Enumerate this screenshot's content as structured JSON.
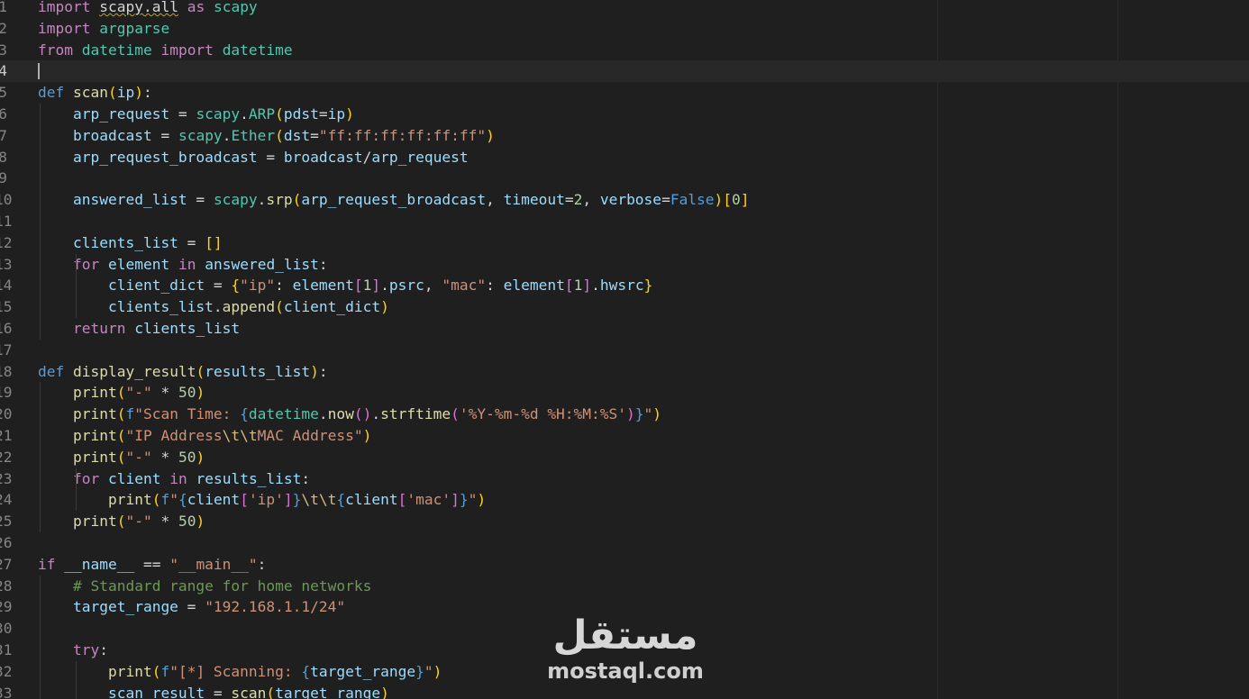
{
  "editor": {
    "current_line": 4,
    "lines": [
      {
        "num": "1",
        "tokens": [
          [
            "import",
            "ctrl"
          ],
          [
            " ",
            ""
          ],
          [
            "scapy.all",
            "sq"
          ],
          [
            " ",
            ""
          ],
          [
            "as",
            "ctrl"
          ],
          [
            " ",
            ""
          ],
          [
            "scapy",
            "mod"
          ]
        ]
      },
      {
        "num": "2",
        "tokens": [
          [
            "import",
            "ctrl"
          ],
          [
            " ",
            ""
          ],
          [
            "argparse",
            "mod"
          ]
        ]
      },
      {
        "num": "3",
        "tokens": [
          [
            "from",
            "ctrl"
          ],
          [
            " ",
            ""
          ],
          [
            "datetime",
            "mod"
          ],
          [
            " ",
            ""
          ],
          [
            "import",
            "ctrl"
          ],
          [
            " ",
            ""
          ],
          [
            "datetime",
            "cls"
          ]
        ]
      },
      {
        "num": "4",
        "tokens": []
      },
      {
        "num": "5",
        "tokens": [
          [
            "def",
            "kw"
          ],
          [
            " ",
            ""
          ],
          [
            "scan",
            "fn"
          ],
          [
            "(",
            "b1"
          ],
          [
            "ip",
            "par"
          ],
          [
            ")",
            "b1"
          ],
          [
            ":",
            ""
          ]
        ]
      },
      {
        "num": "6",
        "tokens": [
          [
            "    arp_request",
            "vr"
          ],
          [
            " = ",
            ""
          ],
          [
            "scapy",
            "mod"
          ],
          [
            ".",
            ""
          ],
          [
            "ARP",
            "cls"
          ],
          [
            "(",
            "b1"
          ],
          [
            "pdst",
            "par"
          ],
          [
            "=",
            ""
          ],
          [
            "ip",
            "par"
          ],
          [
            ")",
            "b1"
          ]
        ]
      },
      {
        "num": "7",
        "tokens": [
          [
            "    broadcast",
            "vr"
          ],
          [
            " = ",
            ""
          ],
          [
            "scapy",
            "mod"
          ],
          [
            ".",
            ""
          ],
          [
            "Ether",
            "cls"
          ],
          [
            "(",
            "b1"
          ],
          [
            "dst",
            "par"
          ],
          [
            "=",
            ""
          ],
          [
            "\"ff:ff:ff:ff:ff:ff\"",
            "str"
          ],
          [
            ")",
            "b1"
          ]
        ]
      },
      {
        "num": "8",
        "tokens": [
          [
            "    arp_request_broadcast",
            "vr"
          ],
          [
            " = ",
            ""
          ],
          [
            "broadcast",
            "vr"
          ],
          [
            "/",
            ""
          ],
          [
            "arp_request",
            "vr"
          ]
        ]
      },
      {
        "num": "9",
        "tokens": []
      },
      {
        "num": "10",
        "tokens": [
          [
            "    answered_list",
            "vr"
          ],
          [
            " = ",
            ""
          ],
          [
            "scapy",
            "mod"
          ],
          [
            ".",
            ""
          ],
          [
            "srp",
            "fn"
          ],
          [
            "(",
            "b1"
          ],
          [
            "arp_request_broadcast",
            "vr"
          ],
          [
            ", ",
            ""
          ],
          [
            "timeout",
            "par"
          ],
          [
            "=",
            ""
          ],
          [
            "2",
            "num"
          ],
          [
            ", ",
            ""
          ],
          [
            "verbose",
            "par"
          ],
          [
            "=",
            ""
          ],
          [
            "False",
            "kw"
          ],
          [
            ")",
            "b1"
          ],
          [
            "[",
            "b1"
          ],
          [
            "0",
            "num"
          ],
          [
            "]",
            "b1"
          ]
        ]
      },
      {
        "num": "11",
        "tokens": []
      },
      {
        "num": "12",
        "tokens": [
          [
            "    clients_list",
            "vr"
          ],
          [
            " = ",
            ""
          ],
          [
            "[]",
            "b1"
          ]
        ]
      },
      {
        "num": "13",
        "tokens": [
          [
            "    ",
            ""
          ],
          [
            "for",
            "ctrl"
          ],
          [
            " ",
            ""
          ],
          [
            "element",
            "vr"
          ],
          [
            " ",
            ""
          ],
          [
            "in",
            "ctrl"
          ],
          [
            " ",
            ""
          ],
          [
            "answered_list",
            "vr"
          ],
          [
            ":",
            ""
          ]
        ]
      },
      {
        "num": "14",
        "tokens": [
          [
            "        client_dict",
            "vr"
          ],
          [
            " = ",
            ""
          ],
          [
            "{",
            "b1"
          ],
          [
            "\"ip\"",
            "str"
          ],
          [
            ": ",
            ""
          ],
          [
            "element",
            "vr"
          ],
          [
            "[",
            "b2"
          ],
          [
            "1",
            "num"
          ],
          [
            "]",
            "b2"
          ],
          [
            ".",
            ""
          ],
          [
            "psrc",
            "vr"
          ],
          [
            ", ",
            ""
          ],
          [
            "\"mac\"",
            "str"
          ],
          [
            ": ",
            ""
          ],
          [
            "element",
            "vr"
          ],
          [
            "[",
            "b2"
          ],
          [
            "1",
            "num"
          ],
          [
            "]",
            "b2"
          ],
          [
            ".",
            ""
          ],
          [
            "hwsrc",
            "vr"
          ],
          [
            "}",
            "b1"
          ]
        ]
      },
      {
        "num": "15",
        "tokens": [
          [
            "        clients_list",
            "vr"
          ],
          [
            ".",
            ""
          ],
          [
            "append",
            "fn"
          ],
          [
            "(",
            "b1"
          ],
          [
            "client_dict",
            "vr"
          ],
          [
            ")",
            "b1"
          ]
        ]
      },
      {
        "num": "16",
        "tokens": [
          [
            "    ",
            ""
          ],
          [
            "return",
            "ctrl"
          ],
          [
            " ",
            ""
          ],
          [
            "clients_list",
            "vr"
          ]
        ]
      },
      {
        "num": "17",
        "tokens": []
      },
      {
        "num": "18",
        "tokens": [
          [
            "def",
            "kw"
          ],
          [
            " ",
            ""
          ],
          [
            "display_result",
            "fn"
          ],
          [
            "(",
            "b1"
          ],
          [
            "results_list",
            "par"
          ],
          [
            ")",
            "b1"
          ],
          [
            ":",
            ""
          ]
        ]
      },
      {
        "num": "19",
        "tokens": [
          [
            "    ",
            ""
          ],
          [
            "print",
            "fn"
          ],
          [
            "(",
            "b1"
          ],
          [
            "\"-\"",
            "str"
          ],
          [
            " * ",
            ""
          ],
          [
            "50",
            "num"
          ],
          [
            ")",
            "b1"
          ]
        ]
      },
      {
        "num": "20",
        "tokens": [
          [
            "    ",
            ""
          ],
          [
            "print",
            "fn"
          ],
          [
            "(",
            "b1"
          ],
          [
            "f",
            "kw"
          ],
          [
            "\"Scan Time: ",
            "str"
          ],
          [
            "{",
            "kw"
          ],
          [
            "datetime",
            "cls"
          ],
          [
            ".",
            ""
          ],
          [
            "now",
            "fn"
          ],
          [
            "()",
            "b2"
          ],
          [
            ".",
            ""
          ],
          [
            "strftime",
            "fn"
          ],
          [
            "(",
            "b2"
          ],
          [
            "'%Y-%m-%d %H:%M:%S'",
            "str"
          ],
          [
            ")",
            "b2"
          ],
          [
            "}",
            "kw"
          ],
          [
            "\"",
            "str"
          ],
          [
            ")",
            "b1"
          ]
        ]
      },
      {
        "num": "21",
        "tokens": [
          [
            "    ",
            ""
          ],
          [
            "print",
            "fn"
          ],
          [
            "(",
            "b1"
          ],
          [
            "\"IP Address",
            "str"
          ],
          [
            "\\t\\t",
            "esc"
          ],
          [
            "MAC Address\"",
            "str"
          ],
          [
            ")",
            "b1"
          ]
        ]
      },
      {
        "num": "22",
        "tokens": [
          [
            "    ",
            ""
          ],
          [
            "print",
            "fn"
          ],
          [
            "(",
            "b1"
          ],
          [
            "\"-\"",
            "str"
          ],
          [
            " * ",
            ""
          ],
          [
            "50",
            "num"
          ],
          [
            ")",
            "b1"
          ]
        ]
      },
      {
        "num": "23",
        "tokens": [
          [
            "    ",
            ""
          ],
          [
            "for",
            "ctrl"
          ],
          [
            " ",
            ""
          ],
          [
            "client",
            "vr"
          ],
          [
            " ",
            ""
          ],
          [
            "in",
            "ctrl"
          ],
          [
            " ",
            ""
          ],
          [
            "results_list",
            "par"
          ],
          [
            ":",
            ""
          ]
        ]
      },
      {
        "num": "24",
        "tokens": [
          [
            "        ",
            ""
          ],
          [
            "print",
            "fn"
          ],
          [
            "(",
            "b1"
          ],
          [
            "f",
            "kw"
          ],
          [
            "\"",
            "str"
          ],
          [
            "{",
            "kw"
          ],
          [
            "client",
            "vr"
          ],
          [
            "[",
            "b2"
          ],
          [
            "'ip'",
            "str"
          ],
          [
            "]",
            "b2"
          ],
          [
            "}",
            "kw"
          ],
          [
            "\\t\\t",
            "esc"
          ],
          [
            "{",
            "kw"
          ],
          [
            "client",
            "vr"
          ],
          [
            "[",
            "b2"
          ],
          [
            "'mac'",
            "str"
          ],
          [
            "]",
            "b2"
          ],
          [
            "}",
            "kw"
          ],
          [
            "\"",
            "str"
          ],
          [
            ")",
            "b1"
          ]
        ]
      },
      {
        "num": "25",
        "tokens": [
          [
            "    ",
            ""
          ],
          [
            "print",
            "fn"
          ],
          [
            "(",
            "b1"
          ],
          [
            "\"-\"",
            "str"
          ],
          [
            " * ",
            ""
          ],
          [
            "50",
            "num"
          ],
          [
            ")",
            "b1"
          ]
        ]
      },
      {
        "num": "26",
        "tokens": []
      },
      {
        "num": "27",
        "tokens": [
          [
            "if",
            "ctrl"
          ],
          [
            " ",
            ""
          ],
          [
            "__name__",
            "vr"
          ],
          [
            " == ",
            ""
          ],
          [
            "\"__main__\"",
            "str"
          ],
          [
            ":",
            ""
          ]
        ]
      },
      {
        "num": "28",
        "tokens": [
          [
            "    # Standard range for home networks",
            "cmt"
          ]
        ]
      },
      {
        "num": "29",
        "tokens": [
          [
            "    target_range",
            "vr"
          ],
          [
            " = ",
            ""
          ],
          [
            "\"192.168.1.1/24\"",
            "str"
          ]
        ]
      },
      {
        "num": "30",
        "tokens": []
      },
      {
        "num": "31",
        "tokens": [
          [
            "    ",
            ""
          ],
          [
            "try",
            "ctrl"
          ],
          [
            ":",
            ""
          ]
        ]
      },
      {
        "num": "32",
        "tokens": [
          [
            "        ",
            ""
          ],
          [
            "print",
            "fn"
          ],
          [
            "(",
            "b1"
          ],
          [
            "f",
            "kw"
          ],
          [
            "\"[*] Scanning: ",
            "str"
          ],
          [
            "{",
            "kw"
          ],
          [
            "target_range",
            "vr"
          ],
          [
            "}",
            "kw"
          ],
          [
            "\"",
            "str"
          ],
          [
            ")",
            "b1"
          ]
        ]
      },
      {
        "num": "33",
        "tokens": [
          [
            "        scan_result",
            "vr"
          ],
          [
            " = ",
            ""
          ],
          [
            "scan",
            "fn"
          ],
          [
            "(",
            "b1"
          ],
          [
            "target_range",
            "vr"
          ],
          [
            ")",
            "b1"
          ]
        ]
      }
    ]
  },
  "watermark": {
    "arabic": "مستقل",
    "latin": "mostaql.com"
  }
}
